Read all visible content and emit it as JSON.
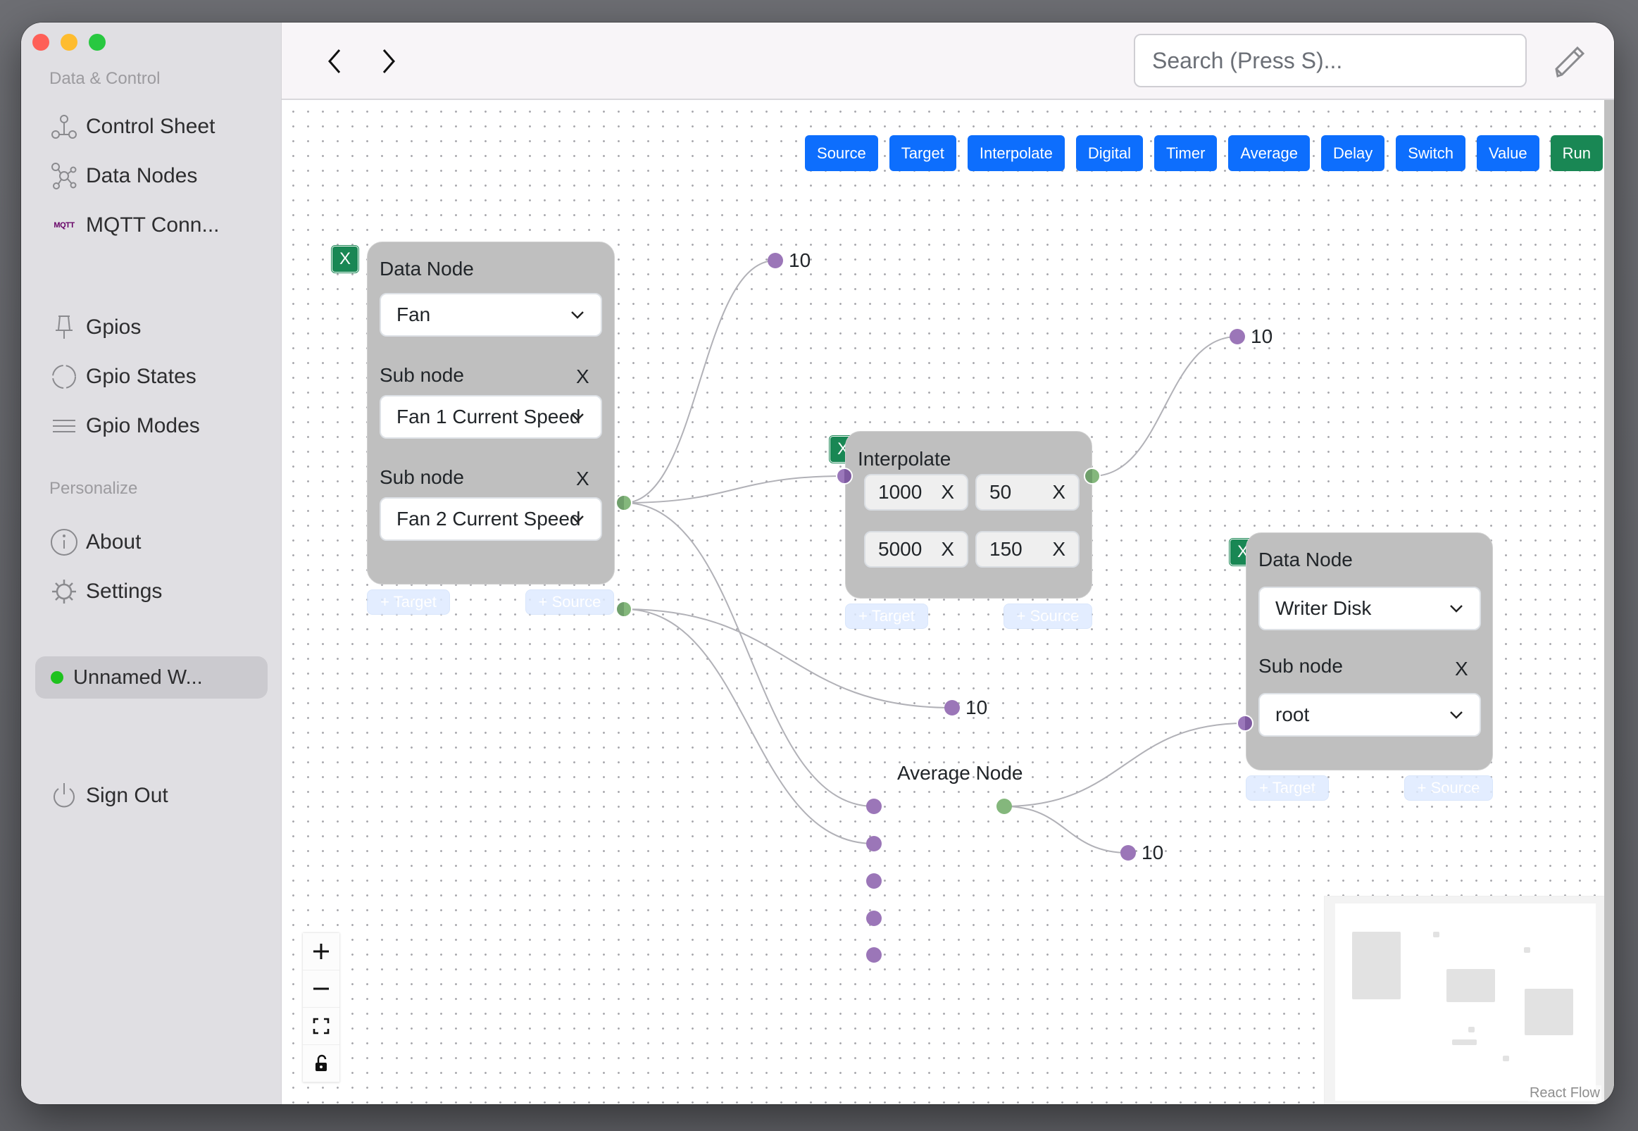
{
  "window": {
    "traffic_lights": [
      "close",
      "minimize",
      "zoom"
    ]
  },
  "sidebar": {
    "sections": [
      {
        "title": "Data & Control",
        "items": [
          {
            "label": "Control Sheet",
            "icon": "control-sheet-icon"
          },
          {
            "label": "Data Nodes",
            "icon": "data-nodes-icon"
          },
          {
            "label": "MQTT Conn...",
            "icon": "mqtt-icon",
            "icon_text": "MQTT"
          },
          {
            "label": "Gpios",
            "icon": "pin-icon"
          },
          {
            "label": "Gpio States",
            "icon": "dashed-circle-icon"
          },
          {
            "label": "Gpio Modes",
            "icon": "lines-icon"
          }
        ]
      },
      {
        "title": "Personalize",
        "items": [
          {
            "label": "About",
            "icon": "info-icon"
          },
          {
            "label": "Settings",
            "icon": "gear-icon"
          }
        ]
      }
    ],
    "workspace": {
      "label": "Unnamed W...",
      "status_color": "#1ec21e"
    },
    "sign_out": {
      "label": "Sign Out",
      "icon": "power-icon"
    }
  },
  "header": {
    "back_icon": "chevron-left-icon",
    "forward_icon": "chevron-right-icon",
    "search": {
      "placeholder": "Search (Press S)...",
      "value": ""
    },
    "edit_icon": "pencil-icon"
  },
  "toolbar": {
    "buttons": [
      "Source",
      "Target",
      "Interpolate",
      "Digital",
      "Timer",
      "Average",
      "Delay",
      "Switch",
      "Value"
    ],
    "run_label": "Run",
    "colors": {
      "primary": "#0d6efd",
      "run": "#198754"
    }
  },
  "nodes": {
    "data_node_1": {
      "delete_label": "X",
      "title": "Data Node",
      "node_select": "Fan",
      "sub_nodes": [
        {
          "label": "Sub node",
          "remove": "X",
          "value": "Fan 1 Current Speed"
        },
        {
          "label": "Sub node",
          "remove": "X",
          "value": "Fan 2 Current Speed"
        }
      ],
      "add_target": "+ Target",
      "add_source": "+ Source"
    },
    "interpolate": {
      "delete_label": "X",
      "title": "Interpolate",
      "rows": [
        {
          "in": "1000",
          "out": "50"
        },
        {
          "in": "5000",
          "out": "150"
        }
      ],
      "remove": "X",
      "add_target": "+ Target",
      "add_source": "+ Source"
    },
    "data_node_2": {
      "delete_label": "X",
      "title": "Data Node",
      "node_select": "Writer Disk",
      "sub_nodes": [
        {
          "label": "Sub node",
          "remove": "X",
          "value": "root"
        }
      ],
      "add_target": "+ Target",
      "add_source": "+ Source"
    },
    "average": {
      "title": "Average Node",
      "input_count": 5
    },
    "values": [
      "10",
      "10",
      "10",
      "10"
    ]
  },
  "edges": [
    {
      "from": "data_node_1.fan1",
      "to": "value_1"
    },
    {
      "from": "data_node_1.fan1",
      "to": "interpolate.in"
    },
    {
      "from": "data_node_1.fan1",
      "to": "average.in1"
    },
    {
      "from": "data_node_1.fan2",
      "to": "value_3"
    },
    {
      "from": "data_node_1.fan2",
      "to": "average.in2"
    },
    {
      "from": "interpolate.out",
      "to": "value_2"
    },
    {
      "from": "average.out",
      "to": "data_node_2.root"
    },
    {
      "from": "average.out",
      "to": "value_4"
    }
  ],
  "controls": {
    "zoom_in": "zoom-in-icon",
    "zoom_out": "zoom-out-icon",
    "fit": "fit-view-icon",
    "lock": "unlock-icon"
  },
  "attribution": "React Flow"
}
